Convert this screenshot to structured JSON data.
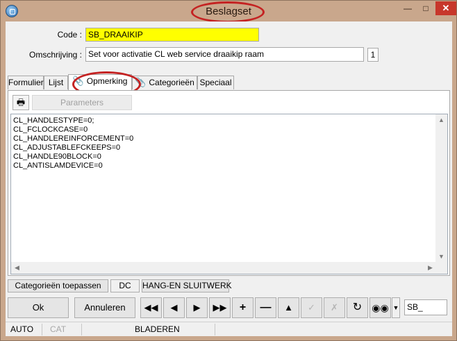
{
  "window": {
    "title": "Beslagset",
    "colors": {
      "frame": "#c9a78c",
      "close": "#c7372b",
      "highlight": "#c42222",
      "code_field": "#ffff00"
    }
  },
  "form": {
    "code_label": "Code :",
    "code_value": "SB_DRAAIKIP",
    "omschrijving_label": "Omschrijving :",
    "omschrijving_value": "Set voor activatie CL web service draaikip raam",
    "counter": "1"
  },
  "tabs": [
    {
      "label": "Formulier"
    },
    {
      "label": "Lijst"
    },
    {
      "label": "Opmerking",
      "icon": "paperclip-icon",
      "active": true
    },
    {
      "label": "Categorieën",
      "icon": "paperclip-icon"
    },
    {
      "label": "Speciaal"
    }
  ],
  "panel": {
    "print_icon": "printer-icon",
    "params_label": "Parameters",
    "memo_lines": [
      "CL_HANDLESTYPE=0;",
      "CL_FCLOCKCASE=0",
      "CL_HANDLEREINFORCEMENT=0",
      "CL_ADJUSTABLEFCKEEPS=0",
      "CL_HANDLE90BLOCK=0",
      "CL_ANTISLAMDEVICE=0"
    ]
  },
  "bottom_bar": {
    "apply_categories": "Categorieën toepassen",
    "dc": "DC",
    "hang_sluitwerk": "HANG-EN SLUITWERK"
  },
  "buttons": {
    "ok": "Ok",
    "cancel": "Annuleren",
    "nav_icons": [
      "first-icon",
      "prev-icon",
      "next-icon",
      "last-icon",
      "plus-icon",
      "minus-icon",
      "up-icon",
      "check-icon",
      "cross-icon",
      "refresh-icon",
      "binoculars-icon",
      "dropdown-icon"
    ],
    "search_value": "SB_"
  },
  "status": {
    "mode": "AUTO",
    "cat": "CAT",
    "state": "BLADEREN"
  }
}
